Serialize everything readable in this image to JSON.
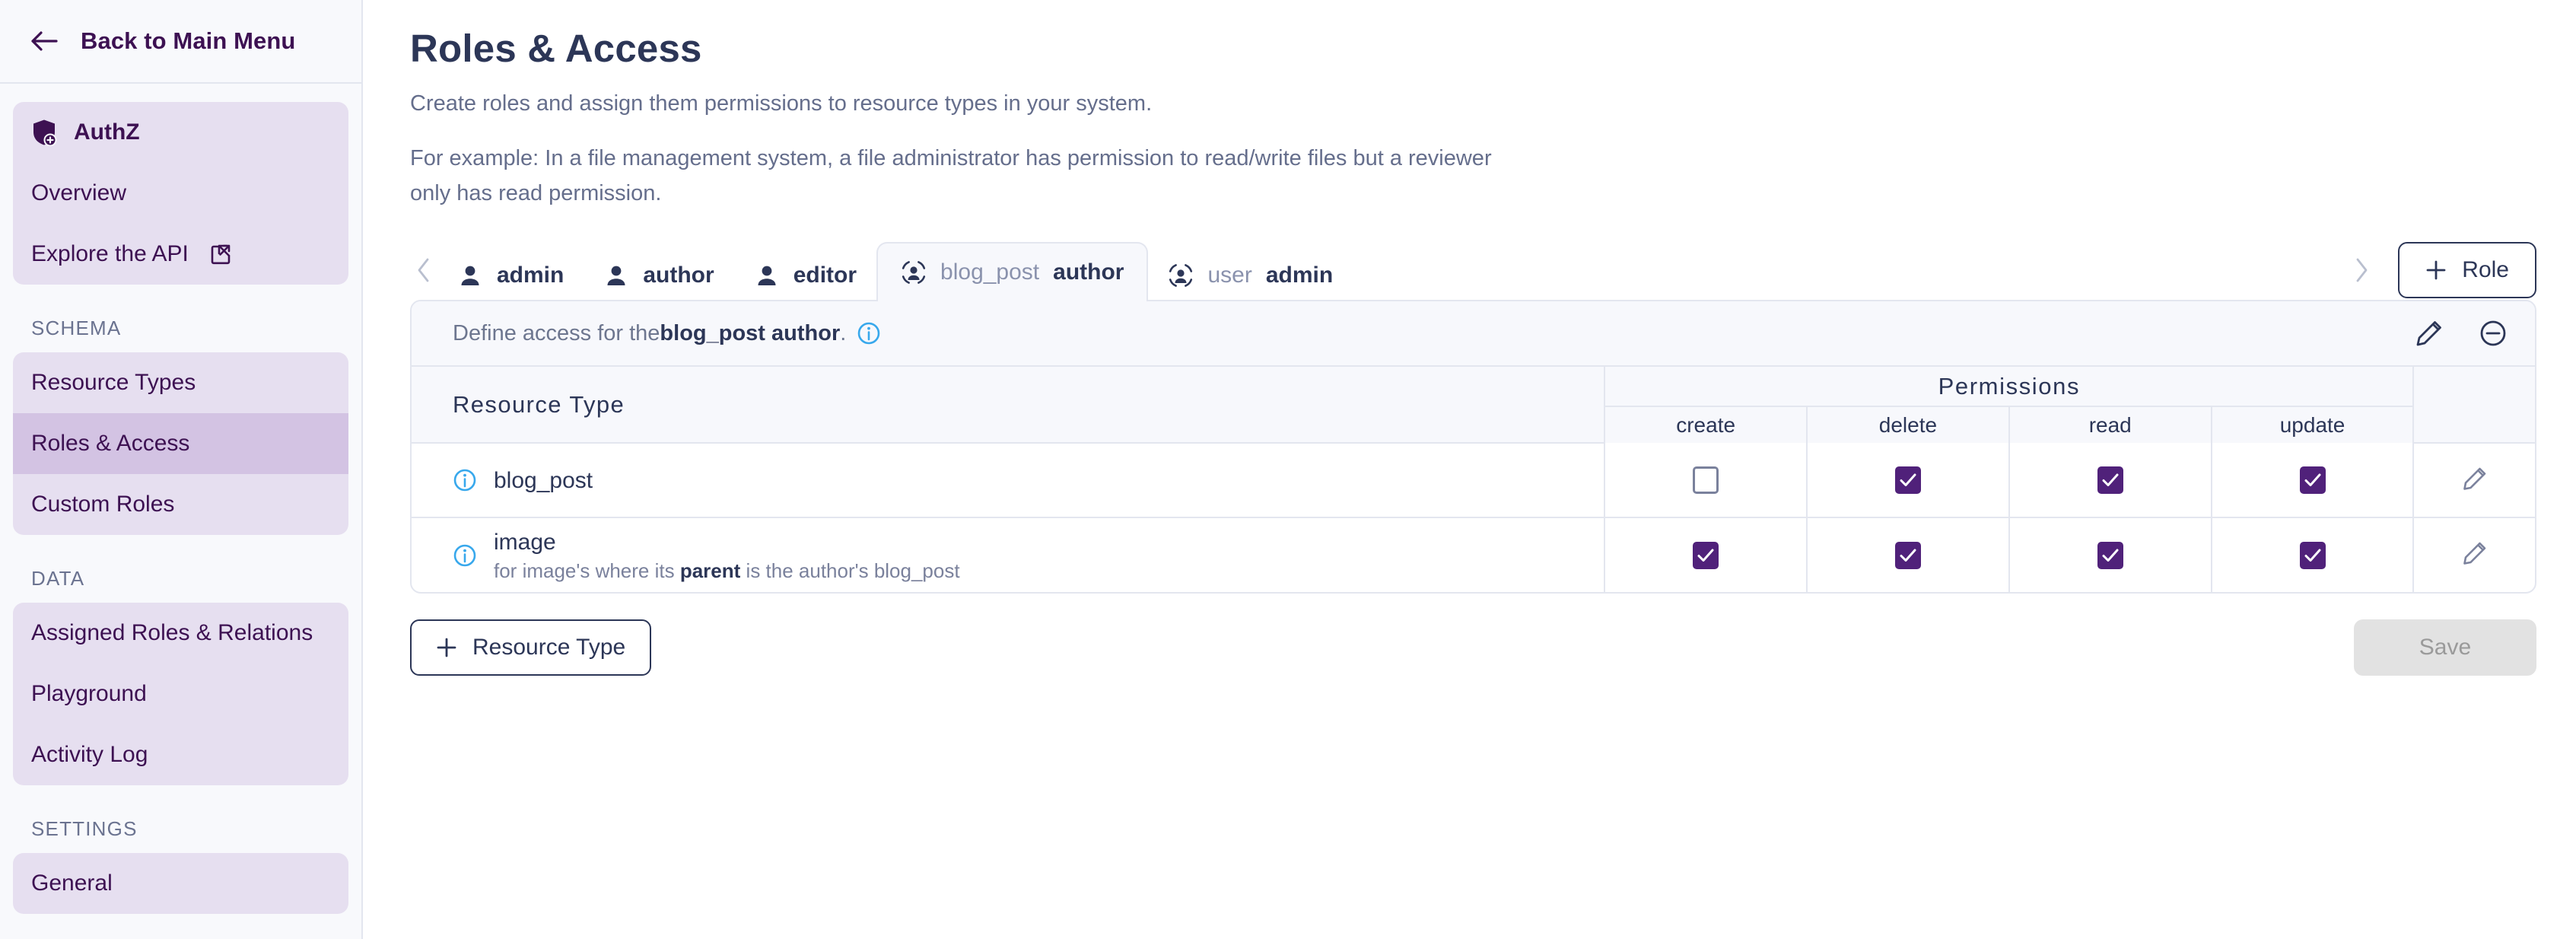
{
  "sidebar": {
    "back_label": "Back to Main Menu",
    "back_icon": "arrow-left-icon",
    "brand": {
      "label": "AuthZ",
      "icon": "shield-plus-icon"
    },
    "top_items": [
      {
        "label": "Overview"
      },
      {
        "label": "Explore the API",
        "icon": "external-link-icon"
      }
    ],
    "sections": [
      {
        "label": "SCHEMA",
        "items": [
          {
            "label": "Resource Types",
            "active": false
          },
          {
            "label": "Roles & Access",
            "active": true
          },
          {
            "label": "Custom Roles",
            "active": false
          }
        ]
      },
      {
        "label": "DATA",
        "items": [
          {
            "label": "Assigned Roles & Relations",
            "active": false
          },
          {
            "label": "Playground",
            "active": false
          },
          {
            "label": "Activity Log",
            "active": false
          }
        ]
      },
      {
        "label": "SETTINGS",
        "items": [
          {
            "label": "General",
            "active": false
          }
        ]
      }
    ]
  },
  "header": {
    "title": "Roles & Access",
    "subtitle": "Create roles and assign them permissions to resource types in your system.",
    "example": "For example: In a file management system, a file administrator has permission to read/write files but a reviewer only has read permission."
  },
  "tabs": {
    "prev_icon": "chevron-left-icon",
    "next_icon": "chevron-right-icon",
    "items": [
      {
        "prefix": "",
        "name": "admin",
        "icon": "user-icon",
        "active": false
      },
      {
        "prefix": "",
        "name": "author",
        "icon": "user-icon",
        "active": false
      },
      {
        "prefix": "",
        "name": "editor",
        "icon": "user-icon",
        "active": false
      },
      {
        "prefix": "blog_post",
        "name": "author",
        "icon": "user-relation-icon",
        "active": true
      },
      {
        "prefix": "user",
        "name": "admin",
        "icon": "user-relation-icon",
        "active": false
      }
    ],
    "add_role_label": "Role",
    "add_role_icon": "plus-icon"
  },
  "panel": {
    "define_prefix": "Define access for the ",
    "define_strong": "blog_post author",
    "define_suffix": ".",
    "define_info_icon": "info-icon",
    "edit_icon": "pencil-icon",
    "remove_icon": "minus-circle-icon",
    "table": {
      "resource_type_header": "Resource Type",
      "permissions_header": "Permissions",
      "permission_columns": [
        "create",
        "delete",
        "read",
        "update"
      ],
      "rows": [
        {
          "info_icon": "info-icon",
          "name": "blog_post",
          "desc_prefix": "",
          "desc_strong": "",
          "desc_suffix": "",
          "permissions": {
            "create": false,
            "delete": true,
            "read": true,
            "update": true
          },
          "row_edit_icon": "pencil-icon"
        },
        {
          "info_icon": "info-icon",
          "name": "image",
          "desc_prefix": "for image's where its ",
          "desc_strong": "parent",
          "desc_suffix": " is the author's blog_post",
          "permissions": {
            "create": true,
            "delete": true,
            "read": true,
            "update": true
          },
          "row_edit_icon": "pencil-icon"
        }
      ]
    }
  },
  "footer": {
    "add_resource_type_label": "Resource Type",
    "add_resource_type_icon": "plus-icon",
    "save_label": "Save"
  },
  "colors": {
    "brand_purple": "#3d1152",
    "checkbox_purple": "#50217a",
    "navy": "#2c3657",
    "muted": "#6d768f",
    "info_blue": "#38a8ec",
    "sidebar_bg": "#f8f9fc",
    "nav_group_bg": "#e6dff0",
    "nav_active_bg": "#d3c3e3"
  }
}
